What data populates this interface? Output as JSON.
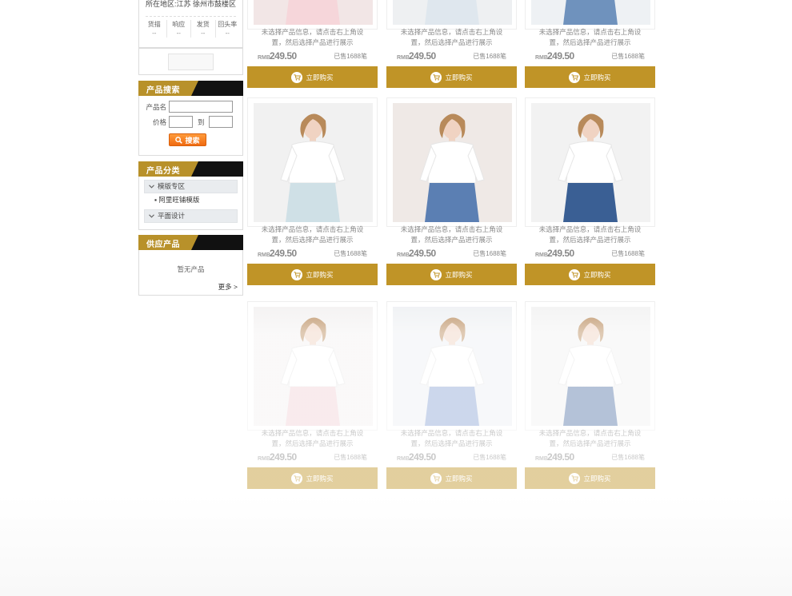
{
  "sidebar": {
    "location": "所在地区:江苏 徐州市鼓楼区",
    "stats": [
      {
        "label": "货描",
        "value": "--"
      },
      {
        "label": "响应",
        "value": "--"
      },
      {
        "label": "发货",
        "value": "--"
      },
      {
        "label": "回头率",
        "value": "--"
      }
    ],
    "search": {
      "title": "产品搜索",
      "name_label": "产品名",
      "price_label": "价格",
      "to_label": "到",
      "button_label": "搜索"
    },
    "categories": {
      "title": "产品分类",
      "items": [
        {
          "label": "模版专区",
          "sub": "阿里旺铺模版"
        },
        {
          "label": "平面设计"
        }
      ]
    },
    "supply": {
      "title": "供应产品",
      "empty": "暂无产品",
      "more": "更多 >"
    }
  },
  "products": [
    {
      "desc1": "未选择产品信息，请点击右上角设",
      "desc2": "置，然后选择产品进行展示",
      "currency": "RMB",
      "price": "249.50",
      "sold": "已售1688笔",
      "button": "立即购买",
      "image": "woman-pink-skirt"
    },
    {
      "desc1": "未选择产品信息，请点击右上角设",
      "desc2": "置，然后选择产品进行展示",
      "currency": "RMB",
      "price": "249.50",
      "sold": "已售1688笔",
      "button": "立即购买",
      "image": "woman-white-skirt"
    },
    {
      "desc1": "未选择产品信息，请点击右上角设",
      "desc2": "置，然后选择产品进行展示",
      "currency": "RMB",
      "price": "249.50",
      "sold": "已售1688笔",
      "button": "立即购买",
      "image": "woman-jeans"
    },
    {
      "desc1": "未选择产品信息，请点击右上角设",
      "desc2": "置，然后选择产品进行展示",
      "currency": "RMB",
      "price": "249.50",
      "sold": "已售1688笔",
      "button": "立即购买",
      "image": "white-tee-plaid-skirt"
    },
    {
      "desc1": "未选择产品信息，请点击右上角设",
      "desc2": "置，然后选择产品进行展示",
      "currency": "RMB",
      "price": "249.50",
      "sold": "已售1688笔",
      "button": "立即购买",
      "image": "floral-blouse-denim-shorts"
    },
    {
      "desc1": "未选择产品信息，请点击右上角设",
      "desc2": "置，然后选择产品进行展示",
      "currency": "RMB",
      "price": "249.50",
      "sold": "已售1688笔",
      "button": "立即购买",
      "image": "white-shirt-embroidered"
    },
    {
      "desc1": "未选择产品信息，请点击右上角设",
      "desc2": "置，然后选择产品进行展示",
      "currency": "RMB",
      "price": "249.50",
      "sold": "已售1688笔",
      "button": "立即购买",
      "image": "white-ruffle-pink-skirt"
    },
    {
      "desc1": "未选择产品信息，请点击右上角设",
      "desc2": "置，然后选择产品进行展示",
      "currency": "RMB",
      "price": "249.50",
      "sold": "已售1688笔",
      "button": "立即购买",
      "image": "blue-stripe-tulle-skirt"
    },
    {
      "desc1": "未选择产品信息，请点击右上角设",
      "desc2": "置，然后选择产品进行展示",
      "currency": "RMB",
      "price": "249.50",
      "sold": "已售1688笔",
      "button": "立即购买",
      "image": "white-tee-crown-jeans"
    }
  ],
  "colors": {
    "gold": "#c09427",
    "black": "#111111",
    "orange": "#f06a10"
  }
}
